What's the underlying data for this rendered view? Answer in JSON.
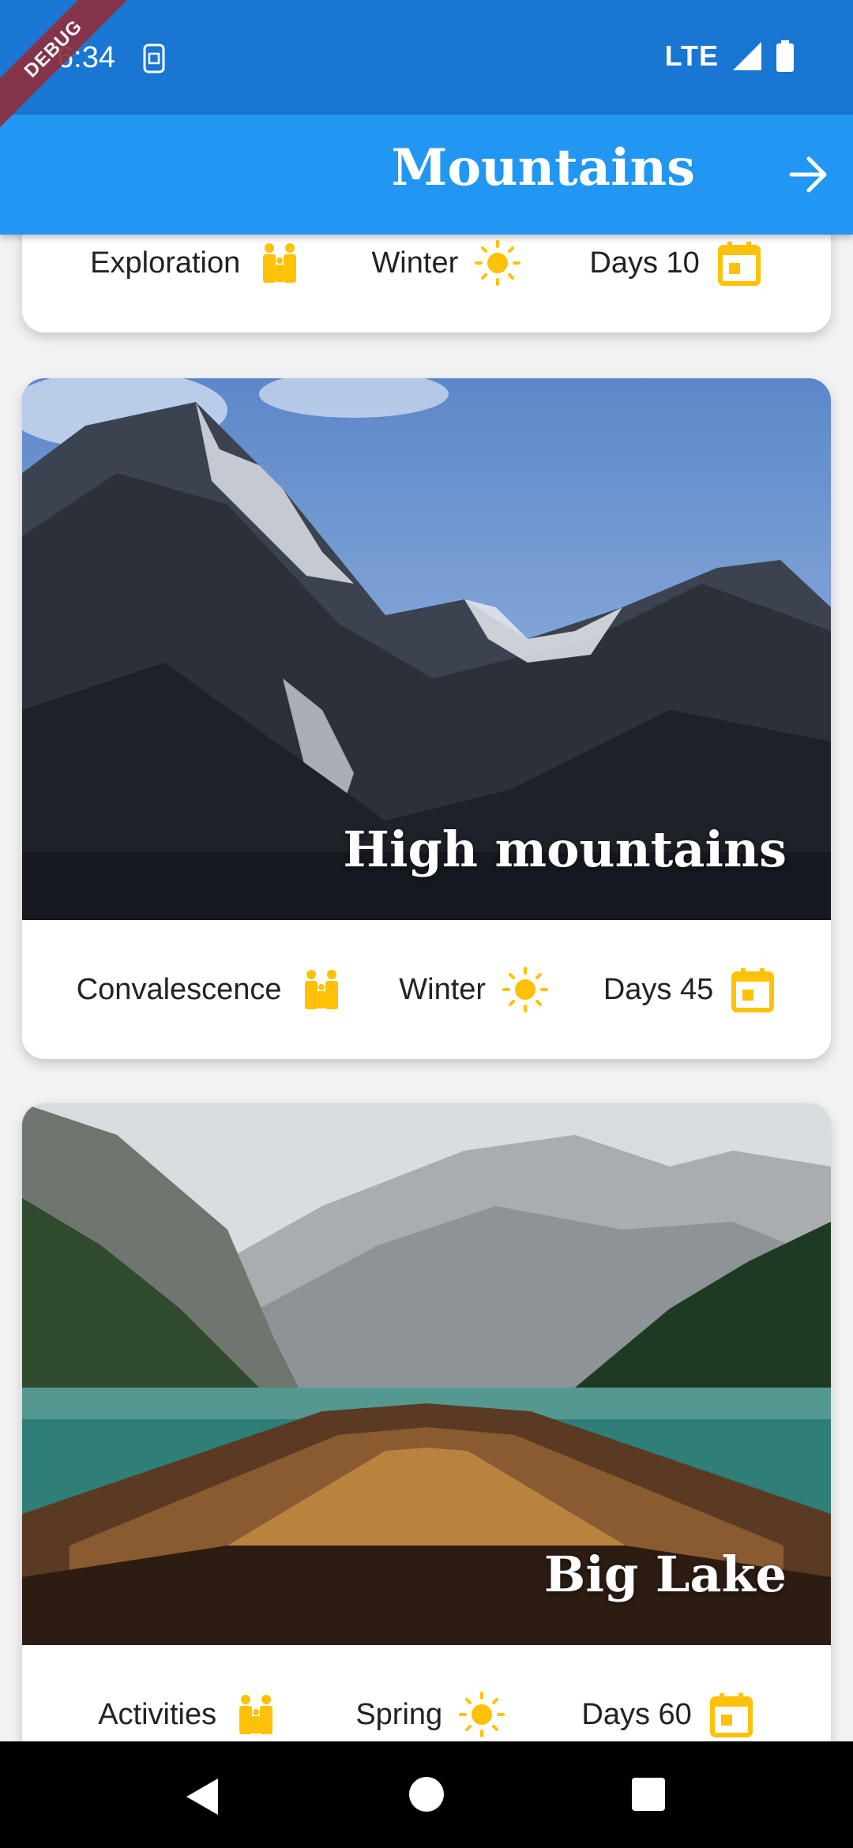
{
  "status_bar": {
    "time": "6:34",
    "network": "LTE",
    "debug_label": "DEBUG"
  },
  "app_bar": {
    "title": "Mountains"
  },
  "cards": [
    {
      "title": "",
      "activity": "Exploration",
      "season": "Winter",
      "days": "Days 10"
    },
    {
      "title": "High mountains",
      "activity": "Convalescence",
      "season": "Winter",
      "days": "Days 45"
    },
    {
      "title": "Big Lake",
      "activity": "Activities",
      "season": "Spring",
      "days": "Days 60"
    }
  ],
  "colors": {
    "status_bar": "#1976d2",
    "app_bar": "#2196f3",
    "icon_accent": "#ffc107"
  },
  "icons": [
    "family-icon",
    "sun-icon",
    "calendar-icon",
    "arrow-forward-icon"
  ]
}
